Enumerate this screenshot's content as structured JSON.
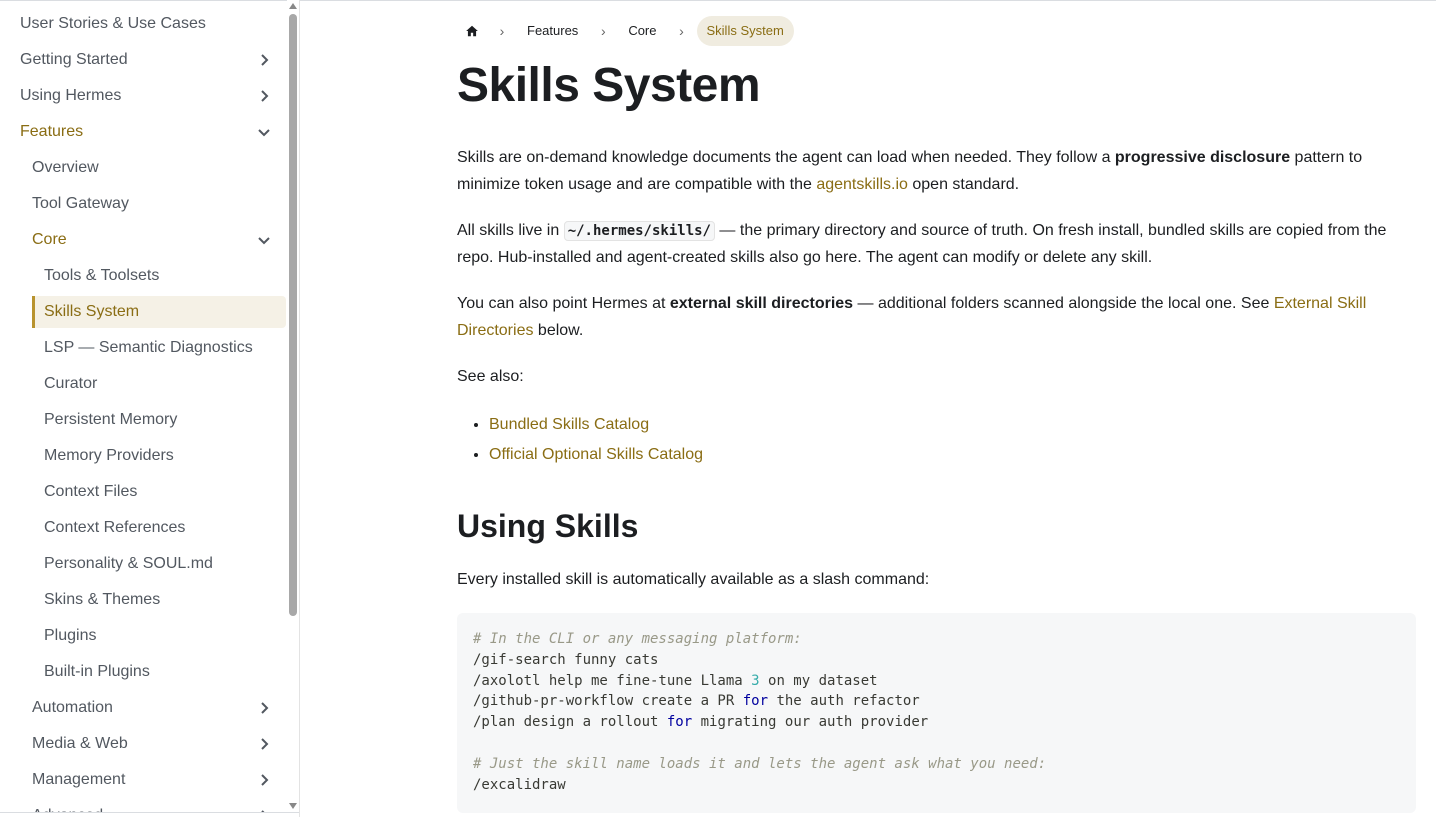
{
  "sidebar": {
    "items": [
      {
        "label": "User Stories & Use Cases",
        "level": 0,
        "chevron": "none"
      },
      {
        "label": "Getting Started",
        "level": 0,
        "chevron": "right"
      },
      {
        "label": "Using Hermes",
        "level": 0,
        "chevron": "right"
      },
      {
        "label": "Features",
        "level": 0,
        "chevron": "down",
        "state": "expanded"
      },
      {
        "label": "Overview",
        "level": 1,
        "chevron": "none"
      },
      {
        "label": "Tool Gateway",
        "level": 1,
        "chevron": "none"
      },
      {
        "label": "Core",
        "level": 1,
        "chevron": "down",
        "state": "expanded"
      },
      {
        "label": "Tools & Toolsets",
        "level": 2,
        "chevron": "none"
      },
      {
        "label": "Skills System",
        "level": 2,
        "chevron": "none",
        "state": "active"
      },
      {
        "label": "LSP — Semantic Diagnostics",
        "level": 2,
        "chevron": "none"
      },
      {
        "label": "Curator",
        "level": 2,
        "chevron": "none"
      },
      {
        "label": "Persistent Memory",
        "level": 2,
        "chevron": "none"
      },
      {
        "label": "Memory Providers",
        "level": 2,
        "chevron": "none"
      },
      {
        "label": "Context Files",
        "level": 2,
        "chevron": "none"
      },
      {
        "label": "Context References",
        "level": 2,
        "chevron": "none"
      },
      {
        "label": "Personality & SOUL.md",
        "level": 2,
        "chevron": "none"
      },
      {
        "label": "Skins & Themes",
        "level": 2,
        "chevron": "none"
      },
      {
        "label": "Plugins",
        "level": 2,
        "chevron": "none"
      },
      {
        "label": "Built-in Plugins",
        "level": 2,
        "chevron": "none"
      },
      {
        "label": "Automation",
        "level": 1,
        "chevron": "right"
      },
      {
        "label": "Media & Web",
        "level": 1,
        "chevron": "right"
      },
      {
        "label": "Management",
        "level": 1,
        "chevron": "right"
      },
      {
        "label": "Advanced",
        "level": 1,
        "chevron": "right"
      }
    ]
  },
  "breadcrumbs": {
    "home_icon": "home-icon",
    "items": [
      "Features",
      "Core",
      "Skills System"
    ]
  },
  "page": {
    "title": "Skills System",
    "p1": {
      "a": "Skills are on-demand knowledge documents the agent can load when needed. They follow a ",
      "bold": "progressive disclosure",
      "b": " pattern to minimize token usage and are compatible with the ",
      "link": "agentskills.io",
      "c": " open standard."
    },
    "p2": {
      "a": "All skills live in ",
      "code": "~/.hermes/skills/",
      "b": " — the primary directory and source of truth. On fresh install, bundled skills are copied from the repo. Hub-installed and agent-created skills also go here. The agent can modify or delete any skill."
    },
    "p3": {
      "a": "You can also point Hermes at ",
      "bold": "external skill directories",
      "b": " — additional folders scanned alongside the local one. See ",
      "link": "External Skill Directories",
      "c": " below."
    },
    "see_also": "See also:",
    "links": [
      "Bundled Skills Catalog",
      "Official Optional Skills Catalog"
    ],
    "h2": "Using Skills",
    "p4": "Every installed skill is automatically available as a slash command:",
    "code": {
      "c1": "# In the CLI or any messaging platform:",
      "l1": "/gif-search funny cats",
      "l2a": "/axolotl help me fine-tune Llama ",
      "l2n": "3",
      "l2b": " on my dataset",
      "l3a": "/github-pr-workflow create a PR ",
      "l3k": "for",
      "l3b": " the auth refactor",
      "l4a": "/plan design a rollout ",
      "l4k": "for",
      "l4b": " migrating our auth provider",
      "c2": "# Just the skill name loads it and lets the agent ask what you need:",
      "l5": "/excalidraw"
    }
  },
  "colors": {
    "accent": "#8a6d14",
    "active_bg": "#f5f1e6",
    "active_border": "#b8932f",
    "code_bg": "#f6f7f8"
  }
}
